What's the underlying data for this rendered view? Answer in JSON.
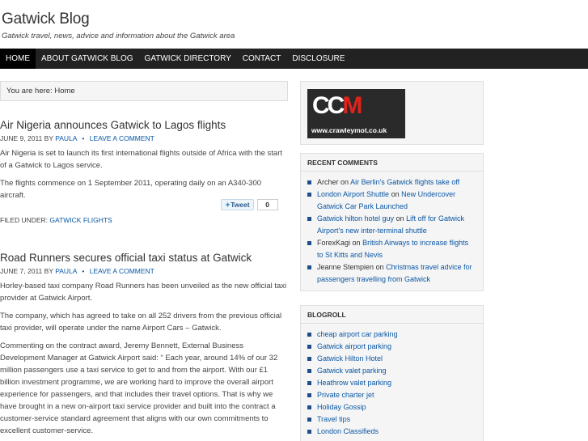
{
  "site": {
    "title": "Gatwick Blog",
    "description": "Gatwick travel, news, advice and information about the Gatwick area"
  },
  "nav": {
    "items": [
      {
        "label": "HOME",
        "active": true
      },
      {
        "label": "ABOUT GATWICK BLOG"
      },
      {
        "label": "GATWICK DIRECTORY"
      },
      {
        "label": "CONTACT"
      },
      {
        "label": "DISCLOSURE"
      }
    ]
  },
  "breadcrumb": "You are here: Home",
  "posts": [
    {
      "title": "Air Nigeria announces Gatwick to Lagos flights",
      "date": "JUNE 9, 2011 BY",
      "author": "PAULA",
      "comment_link": "LEAVE A COMMENT",
      "paragraphs": [
        "Air Nigeria is set to launch its first international flights outside of Africa with the start of a Gatwick to Lagos service.",
        "The flights commence on 1 September 2011, operating daily on an A340-300 aircraft."
      ],
      "tweet_label": "Tweet",
      "tweet_count": "0",
      "filed_label": "FILED UNDER:",
      "filed_category": "GATWICK FLIGHTS"
    },
    {
      "title": "Road Runners secures official taxi status at Gatwick",
      "date": "JUNE 7, 2011 BY",
      "author": "PAULA",
      "comment_link": "LEAVE A COMMENT",
      "paragraphs": [
        "Horley-based taxi company Road Runners has been unveiled as the new official taxi provider at Gatwick Airport.",
        "The company, which has agreed to take on all 252 drivers from the previous official taxi provider, will operate under the name Airport Cars – Gatwick.",
        "Commenting on the contract award, Jeremy Bennett, External Business Development Manager at Gatwick Airport said: “ Each year, around 14% of our 32 million passengers use a taxi service to get to and from the airport. With our £1 billion investment programme, we are working hard to improve the overall airport experience for passengers, and that includes their travel options. That is why we have brought in a new on-airport taxi service provider and built into the contract a customer-service standard agreement that aligns with our own commitments to excellent customer-service."
      ]
    }
  ],
  "sidebar": {
    "ad": {
      "logo_white": "CC",
      "logo_red": "M",
      "url": "www.crawleymot.co.uk"
    },
    "recent_comments": {
      "title": "RECENT COMMENTS",
      "items": [
        {
          "author": "Archer",
          "sep": "on",
          "link": "Air Berlin's Gatwick flights take off"
        },
        {
          "author": "London Airport Shuttle",
          "sep": "on",
          "link": "New Undercover Gatwick Car Park Launched"
        },
        {
          "author": "Gatwick hilton hotel guy",
          "sep": "on",
          "link": "Lift off for Gatwick Airport's new inter-terminal shuttle"
        },
        {
          "author": "ForexKagi",
          "sep": "on",
          "link": "British Airways to increase flights to St Kitts and Nevis"
        },
        {
          "author": "Jeanne Stempien",
          "sep": "on",
          "link": "Christmas travel advice for passengers travelling from Gatwick"
        }
      ]
    },
    "blogroll": {
      "title": "BLOGROLL",
      "items": [
        "cheap airport car parking",
        "Gatwick airport parking",
        "Gatwick Hilton Hotel",
        "Gatwick valet parking",
        "Heathrow valet parking",
        "Private charter jet",
        "Holiday Gossip",
        "Travel tips",
        "London Classifieds"
      ]
    }
  },
  "colors": {
    "nav_bg": "#222222",
    "link": "#0a57a4",
    "bullet": "#1f4f8a",
    "logo_red": "#e0241b"
  }
}
